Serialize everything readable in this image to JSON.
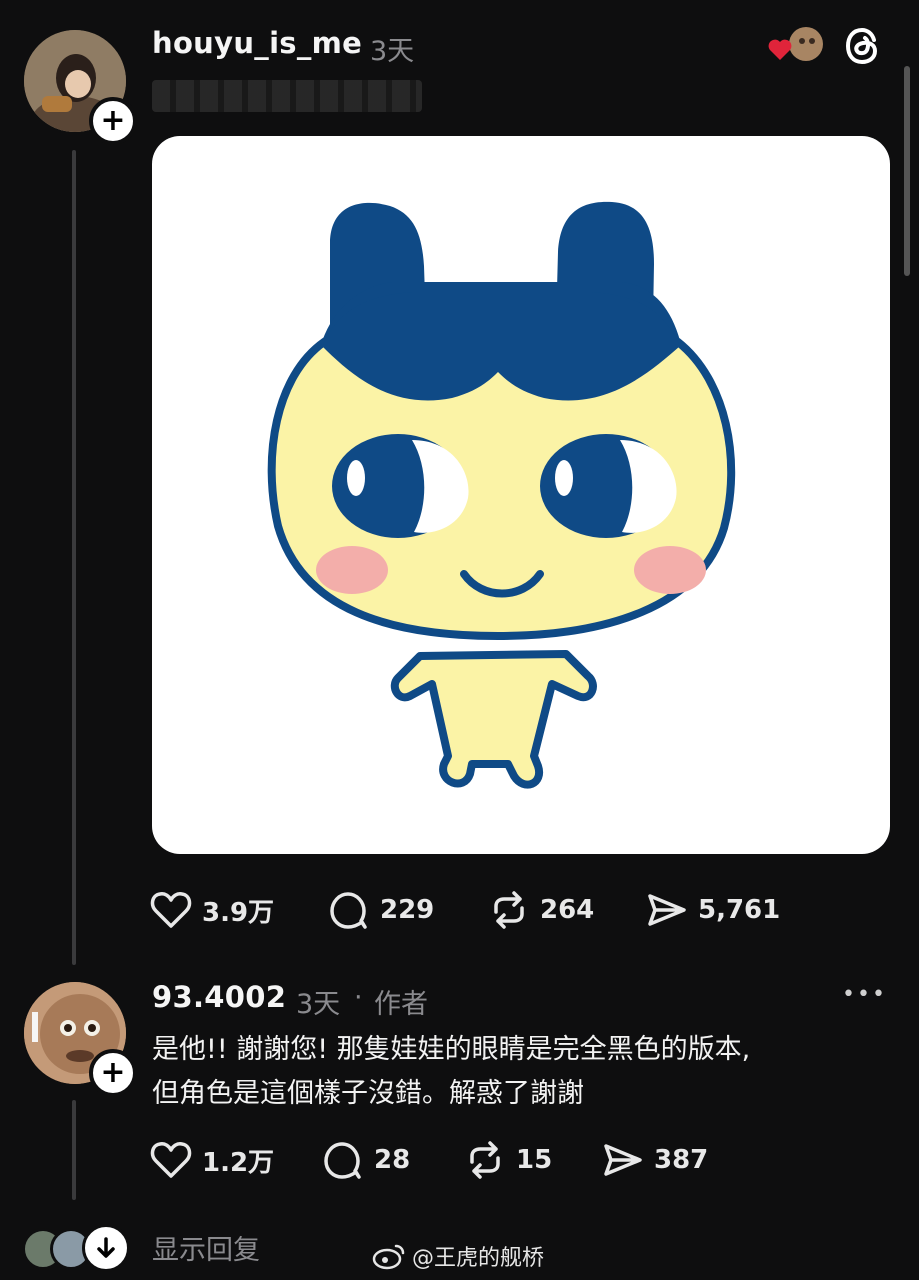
{
  "post": {
    "username": "houyu_is_me",
    "time": "3天",
    "caption": "",
    "stats": {
      "likes": "3.9万",
      "comments": "229",
      "reposts": "264",
      "shares": "5,761"
    }
  },
  "reply": {
    "username": "93.4002",
    "time": "3天",
    "dot": "·",
    "role": "作者",
    "text_line1": "是他!! 謝謝您! 那隻娃娃的眼睛是完全黑色的版本,",
    "text_line2": "但角色是這個樣子沒錯。解惑了謝謝",
    "stats": {
      "likes": "1.2万",
      "comments": "28",
      "reposts": "15",
      "shares": "387"
    },
    "more": "•••"
  },
  "footer": {
    "show_replies": "显示回复",
    "watermark": "@王虎的舰桥"
  },
  "icons": {
    "heart": "heart-icon",
    "comment": "comment-icon",
    "repost": "repost-icon",
    "share": "share-icon",
    "threads": "threads-logo-icon",
    "down": "arrow-down-icon",
    "weibo": "weibo-logo-icon"
  },
  "colors": {
    "accent_red": "#e0243a",
    "character_blue": "#0f4a86",
    "character_yellow": "#fbf3a6",
    "blush": "#f3aeaa"
  }
}
